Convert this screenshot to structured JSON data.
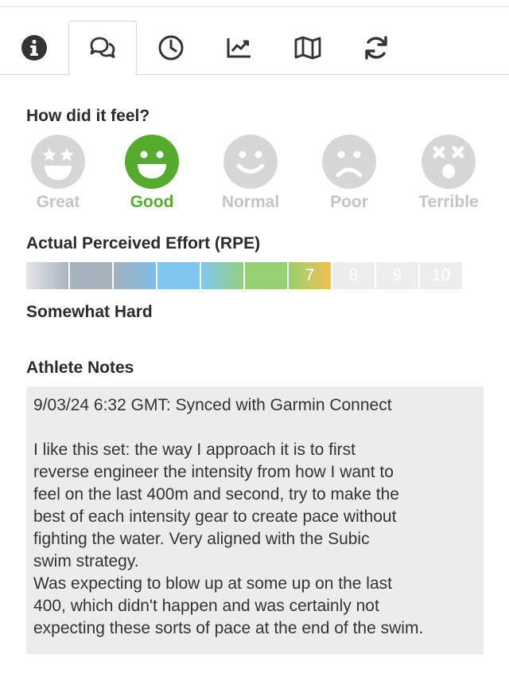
{
  "tabs": [
    {
      "name": "info-icon"
    },
    {
      "name": "comments-icon"
    },
    {
      "name": "clock-icon"
    },
    {
      "name": "chart-icon"
    },
    {
      "name": "map-icon"
    },
    {
      "name": "sync-icon"
    }
  ],
  "feel": {
    "title": "How did it feel?",
    "options": [
      {
        "label": "Great",
        "icon": "star-eyes-face-icon"
      },
      {
        "label": "Good",
        "icon": "big-smile-face-icon",
        "selected": true
      },
      {
        "label": "Normal",
        "icon": "smile-face-icon"
      },
      {
        "label": "Poor",
        "icon": "frown-face-icon"
      },
      {
        "label": "Terrible",
        "icon": "x-eyes-face-icon"
      }
    ],
    "selected_color": "#56ab2f",
    "unselected_color": "#d6d6d6"
  },
  "rpe": {
    "title": "Actual Perceived Effort (RPE)",
    "selected_value": 7,
    "segments": [
      {
        "value": "1",
        "label": ""
      },
      {
        "value": "2",
        "label": ""
      },
      {
        "value": "3",
        "label": ""
      },
      {
        "value": "4",
        "label": ""
      },
      {
        "value": "5",
        "label": ""
      },
      {
        "value": "6",
        "label": ""
      },
      {
        "value": "7",
        "label": "7"
      },
      {
        "value": "8",
        "label": "8"
      },
      {
        "value": "9",
        "label": "9"
      },
      {
        "value": "10",
        "label": "10"
      }
    ],
    "description": "Somewhat Hard"
  },
  "notes": {
    "title": "Athlete Notes",
    "header": "9/03/24 6:32 GMT: Synced with Garmin Connect",
    "body": "I like this set: the way I approach it is to first\nreverse engineer the intensity from how I want to\nfeel on the last 400m and second, try to make the\nbest of each intensity gear to create pace without\nfighting the water. Very aligned with the Subic\nswim strategy.\nWas expecting to blow up at some up on the last\n400, which didn't happen and was certainly not\nexpecting these sorts of pace at the end of the swim."
  }
}
